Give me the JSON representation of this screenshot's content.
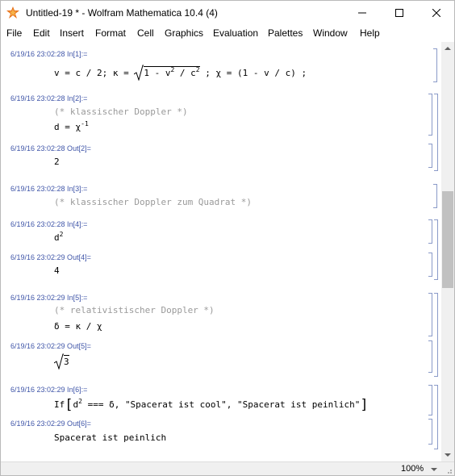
{
  "window": {
    "title": "Untitled-19 * - Wolfram Mathematica 10.4 (4)",
    "minimize_icon": "minimize-icon",
    "maximize_icon": "maximize-icon",
    "close_icon": "close-icon"
  },
  "menu": [
    "File",
    "Edit",
    "Insert",
    "Format",
    "Cell",
    "Graphics",
    "Evaluation",
    "Palettes",
    "Window",
    "Help"
  ],
  "cells": {
    "c1": {
      "label": "6/19/16 23:02:28 In[1]:="
    },
    "c2": {
      "label": "6/19/16 23:02:28 In[2]:=",
      "comment": "(* klassischer Doppler *)"
    },
    "c3": {
      "label": "6/19/16 23:02:28 Out[2]=",
      "output": "2"
    },
    "c4": {
      "label": "6/19/16 23:02:28 In[3]:=",
      "comment": "(* klassischer Doppler zum Quadrat *)"
    },
    "c5": {
      "label": "6/19/16 23:02:28 In[4]:="
    },
    "c6": {
      "label": "6/19/16 23:02:29 Out[4]=",
      "output": "4"
    },
    "c7": {
      "label": "6/19/16 23:02:29 In[5]:=",
      "comment": "(* relativistischer Doppler *)",
      "input": "δ = κ / χ"
    },
    "c8": {
      "label": "6/19/16 23:02:29 Out[5]=",
      "output": "3"
    },
    "c9": {
      "label": "6/19/16 23:02:29 In[6]:=",
      "s1": "\"Spacerat ist cool\"",
      "s2": "\"Spacerat ist peinlich\""
    },
    "c10": {
      "label": "6/19/16 23:02:29 Out[6]=",
      "output": "Spacerat ist peinlich"
    }
  },
  "status": {
    "zoom": "100%"
  },
  "colors": {
    "label": "#3f55a8",
    "comment": "#9a9a9a",
    "bracket": "#8a9ac8"
  }
}
